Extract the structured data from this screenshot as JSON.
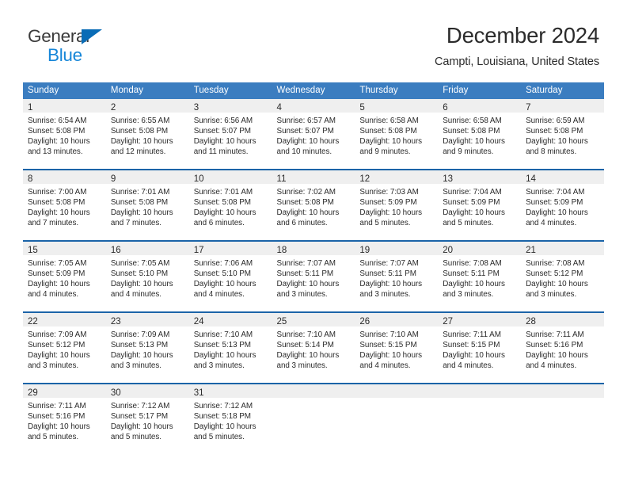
{
  "logo": {
    "text_primary": "General",
    "text_secondary": "Blue",
    "primary_color": "#3b3b3b",
    "secondary_color": "#1686d8",
    "triangle_color": "#0a6cb6"
  },
  "header": {
    "title": "December 2024",
    "subtitle": "Campti, Louisiana, United States"
  },
  "theme": {
    "header_blue": "#3b7dc0",
    "rule_blue": "#1b64a8",
    "band_gray": "#efefef",
    "text": "#2b2b2b"
  },
  "weekday_headers": [
    "Sunday",
    "Monday",
    "Tuesday",
    "Wednesday",
    "Thursday",
    "Friday",
    "Saturday"
  ],
  "weeks": [
    [
      {
        "day": "1",
        "sunrise": "Sunrise: 6:54 AM",
        "sunset": "Sunset: 5:08 PM",
        "daylight_line1": "Daylight: 10 hours",
        "daylight_line2": "and 13 minutes."
      },
      {
        "day": "2",
        "sunrise": "Sunrise: 6:55 AM",
        "sunset": "Sunset: 5:08 PM",
        "daylight_line1": "Daylight: 10 hours",
        "daylight_line2": "and 12 minutes."
      },
      {
        "day": "3",
        "sunrise": "Sunrise: 6:56 AM",
        "sunset": "Sunset: 5:07 PM",
        "daylight_line1": "Daylight: 10 hours",
        "daylight_line2": "and 11 minutes."
      },
      {
        "day": "4",
        "sunrise": "Sunrise: 6:57 AM",
        "sunset": "Sunset: 5:07 PM",
        "daylight_line1": "Daylight: 10 hours",
        "daylight_line2": "and 10 minutes."
      },
      {
        "day": "5",
        "sunrise": "Sunrise: 6:58 AM",
        "sunset": "Sunset: 5:08 PM",
        "daylight_line1": "Daylight: 10 hours",
        "daylight_line2": "and 9 minutes."
      },
      {
        "day": "6",
        "sunrise": "Sunrise: 6:58 AM",
        "sunset": "Sunset: 5:08 PM",
        "daylight_line1": "Daylight: 10 hours",
        "daylight_line2": "and 9 minutes."
      },
      {
        "day": "7",
        "sunrise": "Sunrise: 6:59 AM",
        "sunset": "Sunset: 5:08 PM",
        "daylight_line1": "Daylight: 10 hours",
        "daylight_line2": "and 8 minutes."
      }
    ],
    [
      {
        "day": "8",
        "sunrise": "Sunrise: 7:00 AM",
        "sunset": "Sunset: 5:08 PM",
        "daylight_line1": "Daylight: 10 hours",
        "daylight_line2": "and 7 minutes."
      },
      {
        "day": "9",
        "sunrise": "Sunrise: 7:01 AM",
        "sunset": "Sunset: 5:08 PM",
        "daylight_line1": "Daylight: 10 hours",
        "daylight_line2": "and 7 minutes."
      },
      {
        "day": "10",
        "sunrise": "Sunrise: 7:01 AM",
        "sunset": "Sunset: 5:08 PM",
        "daylight_line1": "Daylight: 10 hours",
        "daylight_line2": "and 6 minutes."
      },
      {
        "day": "11",
        "sunrise": "Sunrise: 7:02 AM",
        "sunset": "Sunset: 5:08 PM",
        "daylight_line1": "Daylight: 10 hours",
        "daylight_line2": "and 6 minutes."
      },
      {
        "day": "12",
        "sunrise": "Sunrise: 7:03 AM",
        "sunset": "Sunset: 5:09 PM",
        "daylight_line1": "Daylight: 10 hours",
        "daylight_line2": "and 5 minutes."
      },
      {
        "day": "13",
        "sunrise": "Sunrise: 7:04 AM",
        "sunset": "Sunset: 5:09 PM",
        "daylight_line1": "Daylight: 10 hours",
        "daylight_line2": "and 5 minutes."
      },
      {
        "day": "14",
        "sunrise": "Sunrise: 7:04 AM",
        "sunset": "Sunset: 5:09 PM",
        "daylight_line1": "Daylight: 10 hours",
        "daylight_line2": "and 4 minutes."
      }
    ],
    [
      {
        "day": "15",
        "sunrise": "Sunrise: 7:05 AM",
        "sunset": "Sunset: 5:09 PM",
        "daylight_line1": "Daylight: 10 hours",
        "daylight_line2": "and 4 minutes."
      },
      {
        "day": "16",
        "sunrise": "Sunrise: 7:05 AM",
        "sunset": "Sunset: 5:10 PM",
        "daylight_line1": "Daylight: 10 hours",
        "daylight_line2": "and 4 minutes."
      },
      {
        "day": "17",
        "sunrise": "Sunrise: 7:06 AM",
        "sunset": "Sunset: 5:10 PM",
        "daylight_line1": "Daylight: 10 hours",
        "daylight_line2": "and 4 minutes."
      },
      {
        "day": "18",
        "sunrise": "Sunrise: 7:07 AM",
        "sunset": "Sunset: 5:11 PM",
        "daylight_line1": "Daylight: 10 hours",
        "daylight_line2": "and 3 minutes."
      },
      {
        "day": "19",
        "sunrise": "Sunrise: 7:07 AM",
        "sunset": "Sunset: 5:11 PM",
        "daylight_line1": "Daylight: 10 hours",
        "daylight_line2": "and 3 minutes."
      },
      {
        "day": "20",
        "sunrise": "Sunrise: 7:08 AM",
        "sunset": "Sunset: 5:11 PM",
        "daylight_line1": "Daylight: 10 hours",
        "daylight_line2": "and 3 minutes."
      },
      {
        "day": "21",
        "sunrise": "Sunrise: 7:08 AM",
        "sunset": "Sunset: 5:12 PM",
        "daylight_line1": "Daylight: 10 hours",
        "daylight_line2": "and 3 minutes."
      }
    ],
    [
      {
        "day": "22",
        "sunrise": "Sunrise: 7:09 AM",
        "sunset": "Sunset: 5:12 PM",
        "daylight_line1": "Daylight: 10 hours",
        "daylight_line2": "and 3 minutes."
      },
      {
        "day": "23",
        "sunrise": "Sunrise: 7:09 AM",
        "sunset": "Sunset: 5:13 PM",
        "daylight_line1": "Daylight: 10 hours",
        "daylight_line2": "and 3 minutes."
      },
      {
        "day": "24",
        "sunrise": "Sunrise: 7:10 AM",
        "sunset": "Sunset: 5:13 PM",
        "daylight_line1": "Daylight: 10 hours",
        "daylight_line2": "and 3 minutes."
      },
      {
        "day": "25",
        "sunrise": "Sunrise: 7:10 AM",
        "sunset": "Sunset: 5:14 PM",
        "daylight_line1": "Daylight: 10 hours",
        "daylight_line2": "and 3 minutes."
      },
      {
        "day": "26",
        "sunrise": "Sunrise: 7:10 AM",
        "sunset": "Sunset: 5:15 PM",
        "daylight_line1": "Daylight: 10 hours",
        "daylight_line2": "and 4 minutes."
      },
      {
        "day": "27",
        "sunrise": "Sunrise: 7:11 AM",
        "sunset": "Sunset: 5:15 PM",
        "daylight_line1": "Daylight: 10 hours",
        "daylight_line2": "and 4 minutes."
      },
      {
        "day": "28",
        "sunrise": "Sunrise: 7:11 AM",
        "sunset": "Sunset: 5:16 PM",
        "daylight_line1": "Daylight: 10 hours",
        "daylight_line2": "and 4 minutes."
      }
    ],
    [
      {
        "day": "29",
        "sunrise": "Sunrise: 7:11 AM",
        "sunset": "Sunset: 5:16 PM",
        "daylight_line1": "Daylight: 10 hours",
        "daylight_line2": "and 5 minutes."
      },
      {
        "day": "30",
        "sunrise": "Sunrise: 7:12 AM",
        "sunset": "Sunset: 5:17 PM",
        "daylight_line1": "Daylight: 10 hours",
        "daylight_line2": "and 5 minutes."
      },
      {
        "day": "31",
        "sunrise": "Sunrise: 7:12 AM",
        "sunset": "Sunset: 5:18 PM",
        "daylight_line1": "Daylight: 10 hours",
        "daylight_line2": "and 5 minutes."
      },
      {
        "day": "",
        "sunrise": "",
        "sunset": "",
        "daylight_line1": "",
        "daylight_line2": ""
      },
      {
        "day": "",
        "sunrise": "",
        "sunset": "",
        "daylight_line1": "",
        "daylight_line2": ""
      },
      {
        "day": "",
        "sunrise": "",
        "sunset": "",
        "daylight_line1": "",
        "daylight_line2": ""
      },
      {
        "day": "",
        "sunrise": "",
        "sunset": "",
        "daylight_line1": "",
        "daylight_line2": ""
      }
    ]
  ]
}
